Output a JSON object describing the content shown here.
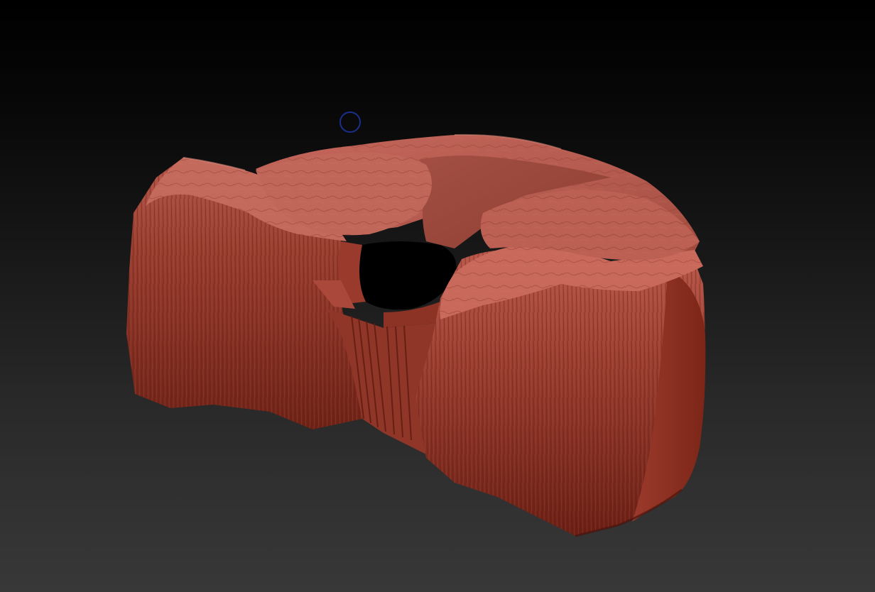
{
  "app": {
    "viewport_label": "",
    "background_top_color": "#000000",
    "background_bottom_color": "#383838"
  },
  "model": {
    "material_base_color": "#8a3022",
    "material_highlight_color": "#c4655a",
    "material_shadow_color": "#4a140d",
    "icon": "terrain-mesh-icon"
  },
  "cursor": {
    "icon": "brush-cursor-icon",
    "color": "#1a2f8c"
  }
}
